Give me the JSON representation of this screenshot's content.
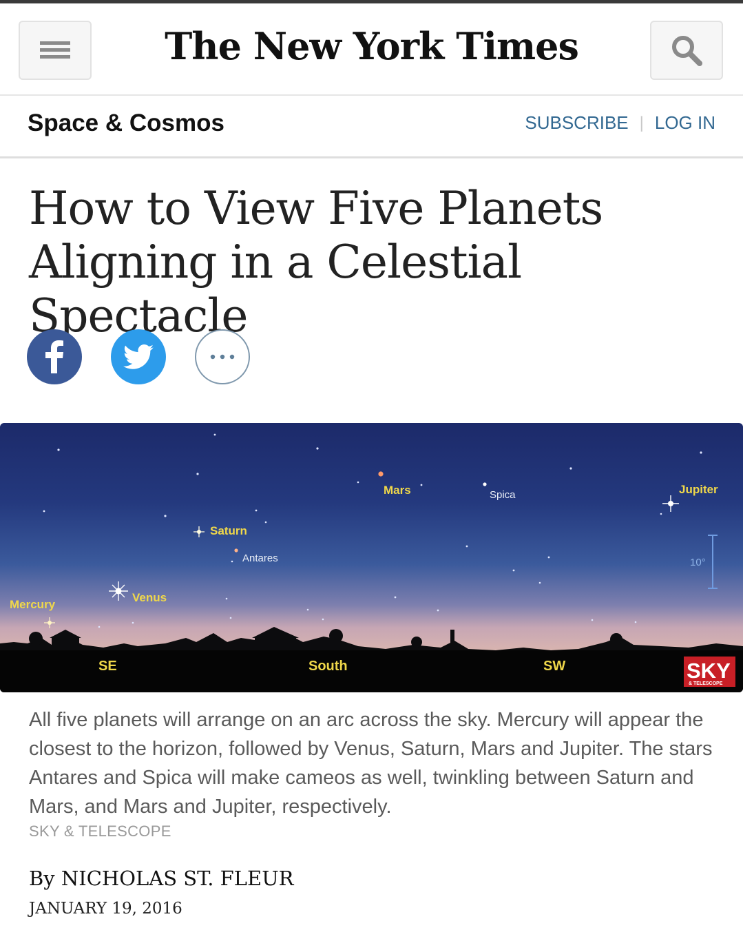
{
  "masthead": {
    "logo": "The New York Times",
    "menu_icon": "hamburger-menu-icon",
    "search_icon": "search-icon"
  },
  "section": {
    "title": "Space & Cosmos",
    "subscribe": "SUBSCRIBE",
    "separator": "|",
    "login": "LOG IN"
  },
  "article": {
    "headline_line1": "How to View Five Planets",
    "headline_line2": "Aligning in a Celestial Spectacle",
    "share": {
      "facebook_icon": "facebook-icon",
      "twitter_icon": "twitter-icon",
      "more_icon": "more-options-icon"
    },
    "figure": {
      "labels": {
        "mercury": "Mercury",
        "venus": "Venus",
        "saturn": "Saturn",
        "antares": "Antares",
        "mars": "Mars",
        "spica": "Spica",
        "jupiter": "Jupiter",
        "scale": "10°",
        "se": "SE",
        "south": "South",
        "sw": "SW",
        "sky_logo": "SKY",
        "sky_logo_sub": "& TELESCOPE"
      }
    },
    "caption": "All five planets will arrange on an arc across the sky. Mercury will appear the closest to the horizon, followed by Venus, Saturn, Mars and Jupiter. The stars Antares and Spica will make cameos as well, twinkling between Saturn and Mars, and Mars and Jupiter, respectively.",
    "credit": "SKY & TELESCOPE",
    "byline": "By NICHOLAS ST. FLEUR",
    "date": "JANUARY 19, 2016"
  },
  "colors": {
    "link": "#326891",
    "facebook": "#3b5998",
    "twitter": "#2d9ceb",
    "planet_label": "#f0d84a",
    "star_label": "#e9eef7"
  }
}
